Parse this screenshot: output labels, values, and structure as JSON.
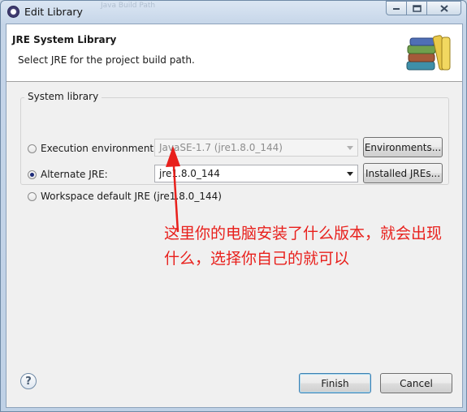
{
  "window": {
    "title": "Edit Library",
    "faint_tab_text": "Java Build Path"
  },
  "caption_buttons": {
    "minimize": "▭",
    "maximize": "□",
    "close": "✕"
  },
  "header": {
    "title": "JRE System Library",
    "description": "Select JRE for the project build path."
  },
  "group": {
    "label": "System library",
    "options": {
      "execution_environment": {
        "label": "Execution environment:",
        "selected": false,
        "combo_value": "JavaSE-1.7 (jre1.8.0_144)",
        "combo_enabled": false,
        "button_label": "Environments..."
      },
      "alternate_jre": {
        "label": "Alternate JRE:",
        "selected": true,
        "combo_value": "jre1.8.0_144",
        "combo_enabled": true,
        "button_label": "Installed JREs..."
      },
      "workspace_default": {
        "label": "Workspace default JRE (jre1.8.0_144)",
        "selected": false
      }
    }
  },
  "annotation": {
    "text": "这里你的电脑安装了什么版本，就会出现什么，选择你自己的就可以",
    "color": "#e8201c"
  },
  "footer": {
    "help_icon": "?",
    "finish_label": "Finish",
    "cancel_label": "Cancel"
  },
  "icons": {
    "title": "eclipse-icon",
    "header": "library-books-icon",
    "help": "help-icon"
  }
}
